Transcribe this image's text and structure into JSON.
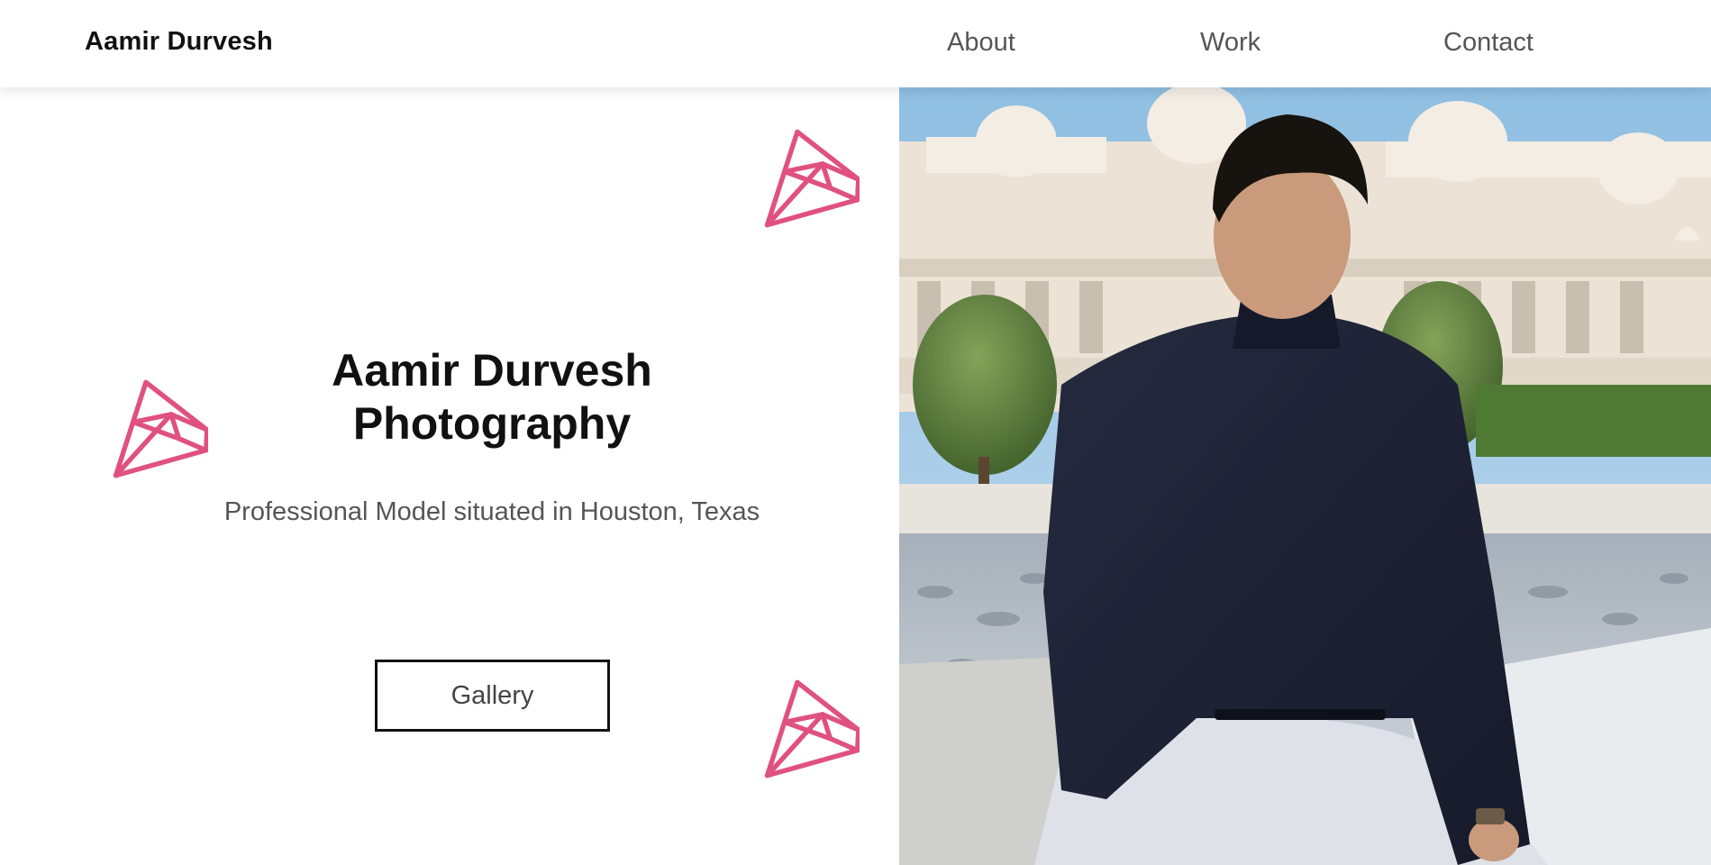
{
  "header": {
    "brand": "Aamir Durvesh",
    "nav": [
      {
        "label": "About"
      },
      {
        "label": "Work"
      },
      {
        "label": "Contact"
      }
    ]
  },
  "hero": {
    "title_line1": "Aamir Durvesh",
    "title_line2": "Photography",
    "subtitle": "Professional Model situated in Houston, Texas",
    "cta_label": "Gallery"
  },
  "decorations": {
    "icon": "diamond-icon",
    "color": "#e0517f",
    "count": 3
  },
  "photo": {
    "subject": "portrait-photo",
    "colors": {
      "sky": "#9fc6e3",
      "temple": "#ece3d6",
      "sweater": "#1e2235",
      "pants": "#dfe1e8",
      "trees": "#5a7c3a"
    }
  }
}
